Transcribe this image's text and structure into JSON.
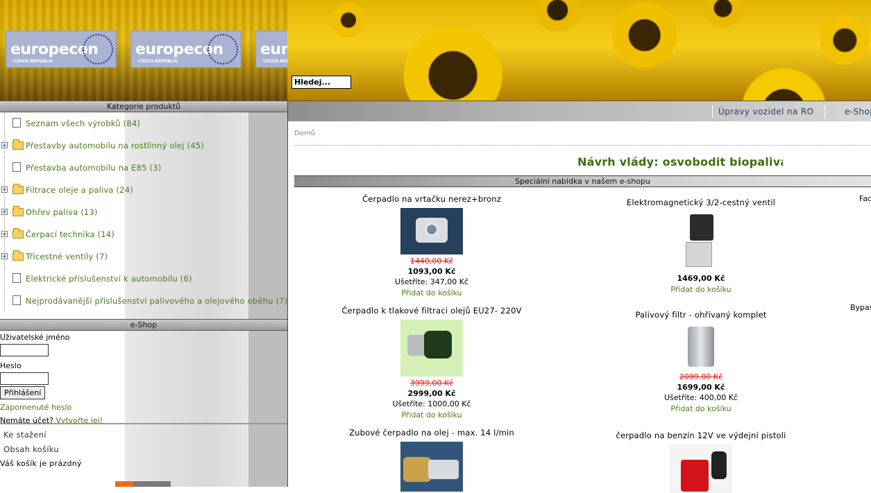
{
  "header": {
    "logo_text": "europecon",
    "logo_subtitle": "CZECH REPUBLIC",
    "search_placeholder": "Hledej..."
  },
  "categories": {
    "title": "Kategorie produktů",
    "items": [
      {
        "label": "Seznam všech výrobků (84)",
        "icon": "document-icon",
        "expandable": false
      },
      {
        "label": "Přestavby automobilu na rostlinný olej (45)",
        "icon": "folder-icon",
        "expandable": true
      },
      {
        "label": "Přestavba automobilu na E85 (3)",
        "icon": "document-icon",
        "expandable": false
      },
      {
        "label": "Filtrace oleje a paliva (24)",
        "icon": "folder-icon",
        "expandable": true
      },
      {
        "label": "Ohřev paliva (13)",
        "icon": "folder-icon",
        "expandable": true
      },
      {
        "label": "Čerpací technika (14)",
        "icon": "folder-icon",
        "expandable": true
      },
      {
        "label": "Třícestné ventily (7)",
        "icon": "folder-icon",
        "expandable": true
      },
      {
        "label": "Elektrické příslušenství k automobilu (6)",
        "icon": "document-icon",
        "expandable": false
      },
      {
        "label": "Nejprodávanější příslušenství palivového a olejového oběhu (7)",
        "icon": "document-icon",
        "expandable": false
      }
    ]
  },
  "eshop": {
    "title": "e-Shop",
    "username_label": "Uživatelské jméno",
    "password_label": "Heslo",
    "login_button": "Přihlášení",
    "forgot_password": "Zapomenuté heslo",
    "no_account_text": "Nemáte účet?",
    "create_account": "Vytvořte jej!"
  },
  "sidebar_links": {
    "downloads": "Ke stažení",
    "cart_contents": "Obsah košíku",
    "cart_empty": "Váš košík je prázdný"
  },
  "nav": {
    "items": [
      "Úpravy vozidel na RO",
      "e-Shop"
    ]
  },
  "breadcrumb": "Domů",
  "headline": "Návrh vlády: osvobodit biopaliva od spotřební daně",
  "special_offer": {
    "title": "Speciální nabídka v našem e-shopu",
    "edge_labels": [
      "Fac",
      "Bypas"
    ],
    "products": [
      {
        "name": "Čerpadlo na vrtačku nerez+bronz",
        "old_price": "1440,00 Kč",
        "new_price": "1093,00 Kč",
        "savings": "Ušetříte: 347,00 Kč",
        "cart": "Přidat do košíku"
      },
      {
        "name": "Elektromagnetický 3/2-cestný ventil",
        "old_price": "",
        "new_price": "1469,00 Kč",
        "savings": "",
        "cart": "Přidat do košíku"
      },
      {
        "name": "Čerpadlo k tlakové filtraci olejů EU27- 220V",
        "old_price": "3999,00 Kč",
        "new_price": "2999,00 Kč",
        "savings": "Ušetříte: 1000,00 Kč",
        "cart": "Přidat do košíku"
      },
      {
        "name": "Palivový filtr - ohřívaný komplet",
        "old_price": "2099,00 Kč",
        "new_price": "1699,00 Kč",
        "savings": "Ušetříte: 400,00 Kč",
        "cart": "Přidat do košíku"
      },
      {
        "name": "Zubové čerpadlo na olej - max. 14 l/min",
        "old_price": "",
        "new_price": "",
        "savings": "",
        "cart": ""
      },
      {
        "name": "čerpadlo na benzín 12V ve výdejní pistoli",
        "old_price": "",
        "new_price": "",
        "savings": "",
        "cart": ""
      }
    ]
  },
  "colors": {
    "link_green": "#4a7a1e",
    "old_price_red": "#e51a1a",
    "nav_text": "#2d3f66",
    "logo_blue": "#aab3d2"
  }
}
